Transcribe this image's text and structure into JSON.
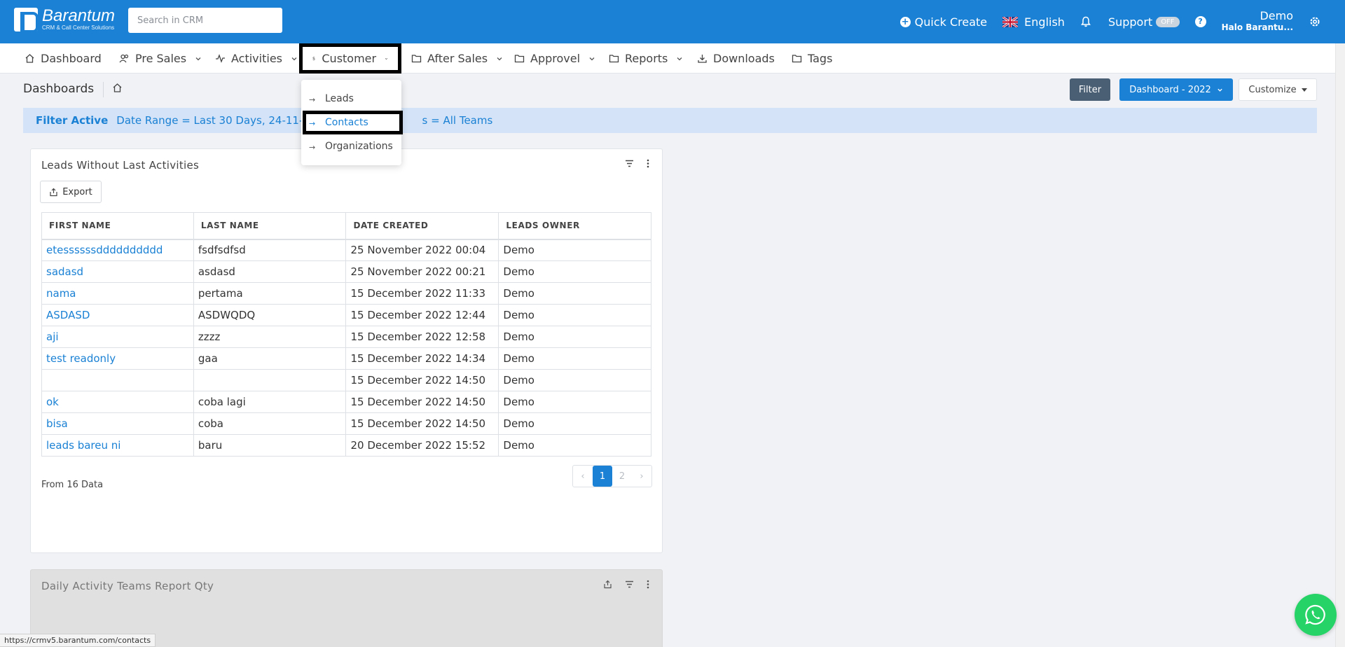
{
  "app": {
    "logo_name": "Barantum",
    "logo_tagline": "CRM & Call Center Solutions"
  },
  "topbar": {
    "search_placeholder": "Search in CRM",
    "quick_create": "Quick Create",
    "language": "English",
    "support": "Support",
    "support_toggle": "OFF",
    "user_name": "Demo",
    "user_greeting": "Halo Barantu..."
  },
  "nav": {
    "items": [
      {
        "label": "Dashboard",
        "icon": "home-icon"
      },
      {
        "label": "Pre Sales",
        "icon": "users-icon"
      },
      {
        "label": "Activities",
        "icon": "activity-icon"
      },
      {
        "label": "Customer",
        "icon": "dollar-icon"
      },
      {
        "label": "After Sales",
        "icon": "folder-icon"
      },
      {
        "label": "Approvel",
        "icon": "folder-icon"
      },
      {
        "label": "Reports",
        "icon": "folder-icon"
      },
      {
        "label": "Downloads",
        "icon": "download-icon"
      },
      {
        "label": "Tags",
        "icon": "folder-icon"
      }
    ]
  },
  "customer_menu": {
    "items": [
      "Leads",
      "Contacts",
      "Organizations"
    ],
    "selected": "Contacts"
  },
  "page": {
    "title": "Dashboards",
    "filter_button": "Filter",
    "dashboard_select": "Dashboard - 2022",
    "customize_button": "Customize"
  },
  "filter_bar": {
    "label": "Filter Active",
    "text_before": "Date Range = Last 30 Days, 24-11-2022",
    "text_after": "s = All Teams"
  },
  "leads_card": {
    "title": "Leads Without Last Activities",
    "export": "Export",
    "columns": [
      "FIRST NAME",
      "LAST NAME",
      "DATE CREATED",
      "LEADS OWNER"
    ],
    "rows": [
      [
        "etessssssdddddddddd",
        "fsdfsdfsd",
        "25 November 2022 00:04",
        "Demo"
      ],
      [
        "sadasd",
        "asdasd",
        "25 November 2022 00:21",
        "Demo"
      ],
      [
        "nama",
        "pertama",
        "15 December 2022 11:33",
        "Demo"
      ],
      [
        "ASDASD",
        "ASDWQDQ",
        "15 December 2022 12:44",
        "Demo"
      ],
      [
        "aji",
        "zzzz",
        "15 December 2022 12:58",
        "Demo"
      ],
      [
        "test readonly",
        "gaa",
        "15 December 2022 14:34",
        "Demo"
      ],
      [
        "",
        "",
        "15 December 2022 14:50",
        "Demo"
      ],
      [
        "ok",
        "coba lagi",
        "15 December 2022 14:50",
        "Demo"
      ],
      [
        "bisa",
        "coba",
        "15 December 2022 14:50",
        "Demo"
      ],
      [
        "leads bareu ni",
        "baru",
        "20 December 2022 15:52",
        "Demo"
      ]
    ],
    "footer": "From 16 Data",
    "pages": [
      "‹",
      "1",
      "2",
      "›"
    ],
    "current_page": "1"
  },
  "activity_card": {
    "title": "Daily Activity Teams Report Qty"
  },
  "statusbar": {
    "url": "https://crmv5.barantum.com/contacts"
  },
  "colors": {
    "primary": "#1a81d4",
    "nav_bg": "#ffffff",
    "filter_bg": "#d4e3f7",
    "whatsapp": "#25d366"
  }
}
